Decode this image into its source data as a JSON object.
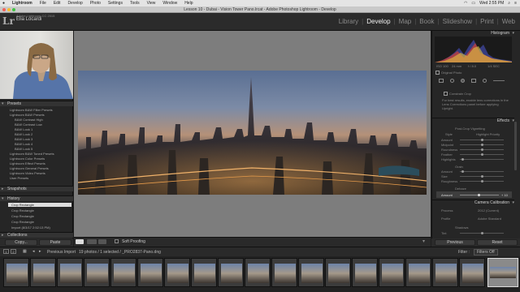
{
  "mac_menu": {
    "app": "Lightroom",
    "items": [
      "File",
      "Edit",
      "Develop",
      "Photo",
      "Settings",
      "Tools",
      "View",
      "Window",
      "Help"
    ],
    "clock": "Wed 2:55 PM"
  },
  "window": {
    "title": "Lesson 10 - Dubai - Vision Tower Pano.lrcat - Adobe Photoshop Lightroom - Develop"
  },
  "identity": {
    "logo": "Lr",
    "product": "Adobe Lightroom CC 2015",
    "user": "Elia Locardi"
  },
  "modules": [
    {
      "label": "Library",
      "active": false
    },
    {
      "label": "Develop",
      "active": true
    },
    {
      "label": "Map",
      "active": false
    },
    {
      "label": "Book",
      "active": false
    },
    {
      "label": "Slideshow",
      "active": false
    },
    {
      "label": "Print",
      "active": false
    },
    {
      "label": "Web",
      "active": false
    }
  ],
  "left_panel": {
    "presets_header": "Presets",
    "presets": [
      {
        "label": "Lightroom B&W Filter Presets",
        "level": 1
      },
      {
        "label": "Lightroom B&W Presets",
        "level": 1
      },
      {
        "label": "B&W Contrast High",
        "level": 2
      },
      {
        "label": "B&W Contrast Low",
        "level": 2
      },
      {
        "label": "B&W Look 1",
        "level": 2
      },
      {
        "label": "B&W Look 2",
        "level": 2
      },
      {
        "label": "B&W Look 3",
        "level": 2
      },
      {
        "label": "B&W Look 4",
        "level": 2
      },
      {
        "label": "B&W Look 5",
        "level": 2
      },
      {
        "label": "Lightroom B&W Toned Presets",
        "level": 1
      },
      {
        "label": "Lightroom Color Presets",
        "level": 1
      },
      {
        "label": "Lightroom Effect Presets",
        "level": 1
      },
      {
        "label": "Lightroom General Presets",
        "level": 1
      },
      {
        "label": "Lightroom Video Presets",
        "level": 1
      },
      {
        "label": "User Presets",
        "level": 1
      }
    ],
    "snapshots_header": "Snapshots",
    "history_header": "History",
    "history": [
      "Crop Rectangle",
      "Crop Rectangle",
      "Crop Rectangle",
      "Crop Rectangle",
      "Import (8/3/17 2:52:13 PM)"
    ],
    "collections_header": "Collections",
    "copy_button": "Copy...",
    "paste_button": "Paste"
  },
  "toolbar": {
    "soft_proofing": "Soft Proofing"
  },
  "right_panel": {
    "histogram_header": "Histogram",
    "histogram_stats": [
      "ISO 100",
      "24 mm",
      "f / 8.0",
      "1/4 SEC"
    ],
    "original_photo": "Original Photo",
    "constrain_crop": "Constrain Crop",
    "transform_note": "For best results, enable lens corrections in the Lens Corrections panel before applying Upright.",
    "effects_header": "Effects",
    "post_crop_vignetting": "Post-Crop Vignetting",
    "style_label": "Style",
    "style_value": "Highlight Priority",
    "vignette_sliders": [
      "Amount",
      "Midpoint",
      "Roundness",
      "Feather",
      "Highlights"
    ],
    "grain_label": "Grain",
    "grain_sliders": [
      "Amount",
      "Size",
      "Roughness"
    ],
    "dehaze_label": "Dehaze",
    "dehaze_amount_label": "Amount",
    "dehaze_amount_value": "+ 10",
    "camera_calibration_header": "Camera Calibration",
    "process_label": "Process",
    "process_value": "2012 (Current)",
    "profile_label": "Profile",
    "profile_value": "Adobe Standard",
    "shadows_label": "Shadows",
    "tint_label": "Tint",
    "previous_button": "Previous",
    "reset_button": "Reset"
  },
  "filmstrip": {
    "page1": "1",
    "page2": "2",
    "import_label": "Previous Import",
    "status": "19 photos / 1 selected / _PRO2837-Pano.dng",
    "filter_label": "Filter :",
    "filter_value": "Filters Off",
    "thumb_count": 19
  }
}
